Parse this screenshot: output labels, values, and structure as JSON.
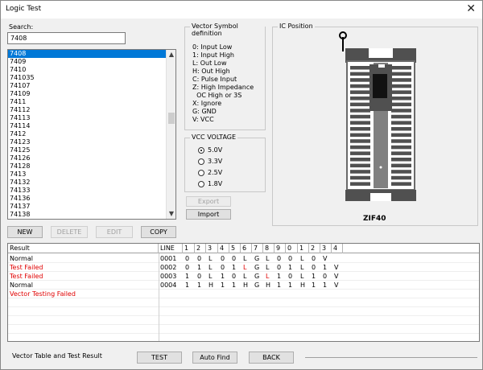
{
  "window": {
    "title": "Logic Test",
    "close_glyph": "✕"
  },
  "search": {
    "label": "Search:",
    "value": "7408"
  },
  "device_list": {
    "items": [
      "7408",
      "7409",
      "7410",
      "741035",
      "74107",
      "74109",
      "7411",
      "74112",
      "74113",
      "74114",
      "7412",
      "74123",
      "74125",
      "74126",
      "74128",
      "7413",
      "74132",
      "74133",
      "74136",
      "74137",
      "74138"
    ],
    "selected": "7408"
  },
  "list_buttons": {
    "new": "NEW",
    "delete": "DELETE",
    "edit": "EDIT",
    "copy": "COPY"
  },
  "vector_symbols": {
    "title": "Vector Symbol definition",
    "lines": [
      "0: Input Low",
      "1: Input High",
      "L: Out Low",
      "H: Out High",
      "C: Pulse Input",
      "Z: High Impedance",
      "  OC High or 3S",
      "X: Ignore",
      "G: GND",
      "V: VCC"
    ]
  },
  "vcc_voltage": {
    "title": "VCC VOLTAGE",
    "options": [
      "5.0V",
      "3.3V",
      "2.5V",
      "1.8V"
    ],
    "selected": "5.0V"
  },
  "io_buttons": {
    "export": "Export",
    "import": "Import"
  },
  "ic_position": {
    "title": "IC Position",
    "socket_label": "ZIF40"
  },
  "result_table": {
    "headers": [
      "Result",
      "LINE",
      "1",
      "2",
      "3",
      "4",
      "5",
      "6",
      "7",
      "8",
      "9",
      "0",
      "1",
      "2",
      "3",
      "4"
    ],
    "rows": [
      {
        "result": "Normal",
        "status": "normal",
        "line": "0001",
        "pins": [
          "0",
          "0",
          "L",
          "0",
          "0",
          "L",
          "G",
          "L",
          "0",
          "0",
          "L",
          "0",
          "V"
        ]
      },
      {
        "result": "Test Failed",
        "status": "failed",
        "line": "0002",
        "pins": [
          "0",
          "1",
          "L",
          "0",
          "1",
          "L",
          "G",
          "L",
          "0",
          "1",
          "L",
          "0",
          "1",
          "V"
        ]
      },
      {
        "result": "Test Failed",
        "status": "failed",
        "line": "0003",
        "pins": [
          "1",
          "0",
          "L",
          "1",
          "0",
          "L",
          "G",
          "L",
          "1",
          "0",
          "L",
          "1",
          "0",
          "V"
        ]
      },
      {
        "result": "Normal",
        "status": "normal",
        "line": "0004",
        "pins": [
          "1",
          "1",
          "H",
          "1",
          "1",
          "H",
          "G",
          "H",
          "1",
          "1",
          "H",
          "1",
          "1",
          "V"
        ]
      },
      {
        "result": "Vector Testing Failed",
        "status": "failed",
        "line": "",
        "pins": []
      }
    ],
    "red_cells": [
      {
        "row": 1,
        "col": 5
      },
      {
        "row": 2,
        "col": 7
      }
    ]
  },
  "footer": {
    "label": "Vector Table and Test Result",
    "test": "TEST",
    "auto_find": "Auto Find",
    "back": "BACK"
  },
  "colors": {
    "selection": "#0078d7",
    "failed": "#e00000"
  }
}
